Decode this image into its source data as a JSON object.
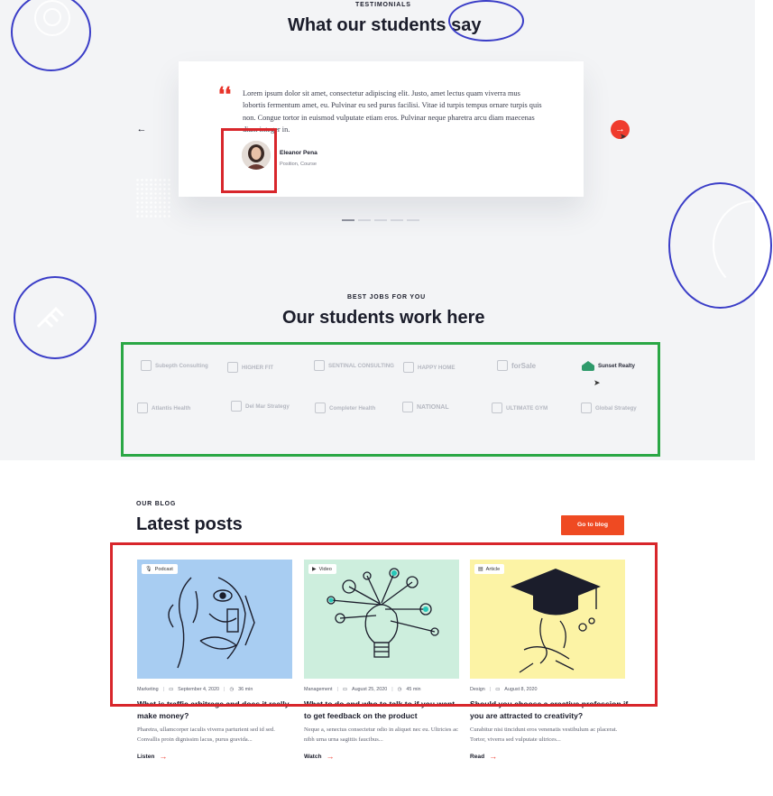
{
  "testimonials": {
    "eyebrow": "TESTIMONIALS",
    "title": "What our students say",
    "quote_mark": "❛❛",
    "quote": "Lorem ipsum dolor sit amet, consectetur adipiscing elit. Justo, amet lectus quam viverra mus lobortis fermentum amet, eu. Pulvinar eu sed purus facilisi. Vitae id turpis tempus ornare turpis quis non. Congue tortor in euismod vulputate etiam eros. Pulvinar neque pharetra arcu diam maecenas diam integer in.",
    "author_name": "Eleanor Pena",
    "author_role": "Position, Course",
    "prev_arrow": "←",
    "next_arrow": "→",
    "pages": 5,
    "active_page": 1
  },
  "companies": {
    "eyebrow": "BEST JOBS FOR YOU",
    "title": "Our students work here",
    "logos": [
      {
        "name": "Subepth Consulting"
      },
      {
        "name": "HIGHER FIT"
      },
      {
        "name": "SENTINAL CONSULTING"
      },
      {
        "name": "HAPPY HOME"
      },
      {
        "name": "forSale"
      },
      {
        "name": "Sunset Realty"
      },
      {
        "name": "Atlantis Health"
      },
      {
        "name": "Del Mar Strategy"
      },
      {
        "name": "Completer Health"
      },
      {
        "name": "NATIONAL"
      },
      {
        "name": "ULTIMATE GYM"
      },
      {
        "name": "Global Strategy"
      }
    ],
    "highlighted_logo": "Sunset Realty"
  },
  "blog": {
    "eyebrow": "OUR BLOG",
    "title": "Latest posts",
    "cta_label": "Go to blog",
    "posts": [
      {
        "tag": "Podcast",
        "tag_icon": "mic-icon",
        "image_color": "#a8cdf2",
        "category": "Marketing",
        "date": "September 4, 2020",
        "duration": "36 min",
        "title": "What is traffic arbitrage and does it really make money?",
        "excerpt": "Pharetra, ullamcorper iaculis viverra parturient sed id sed. Convallis proin dignissim lacus, purus gravida...",
        "link_label": "Listen"
      },
      {
        "tag": "Video",
        "tag_icon": "play-icon",
        "image_color": "#cdeedd",
        "category": "Management",
        "date": "August 25, 2020",
        "duration": "45 min",
        "title": "What to do and who to talk to if you want to get feedback on the product",
        "excerpt": "Neque a, senectus consectetur odio in aliquet nec eu. Ultricies ac nibh urna urna sagittis faucibus...",
        "link_label": "Watch"
      },
      {
        "tag": "Article",
        "tag_icon": "document-icon",
        "image_color": "#fcf3a5",
        "category": "Design",
        "date": "August 8, 2020",
        "duration": "",
        "title": "Should you choose a creative profession if you are attracted to creativity?",
        "excerpt": "Curabitur nisi tincidunt eros venenatis vestibulum ac placerat. Tortor, viverra sed vulputate ultrices...",
        "link_label": "Read"
      }
    ]
  },
  "colors": {
    "accent": "#ef3b2d",
    "annotation_blue": "#3a3dc7",
    "annotation_red": "#d8262b",
    "annotation_green": "#2aa745"
  }
}
